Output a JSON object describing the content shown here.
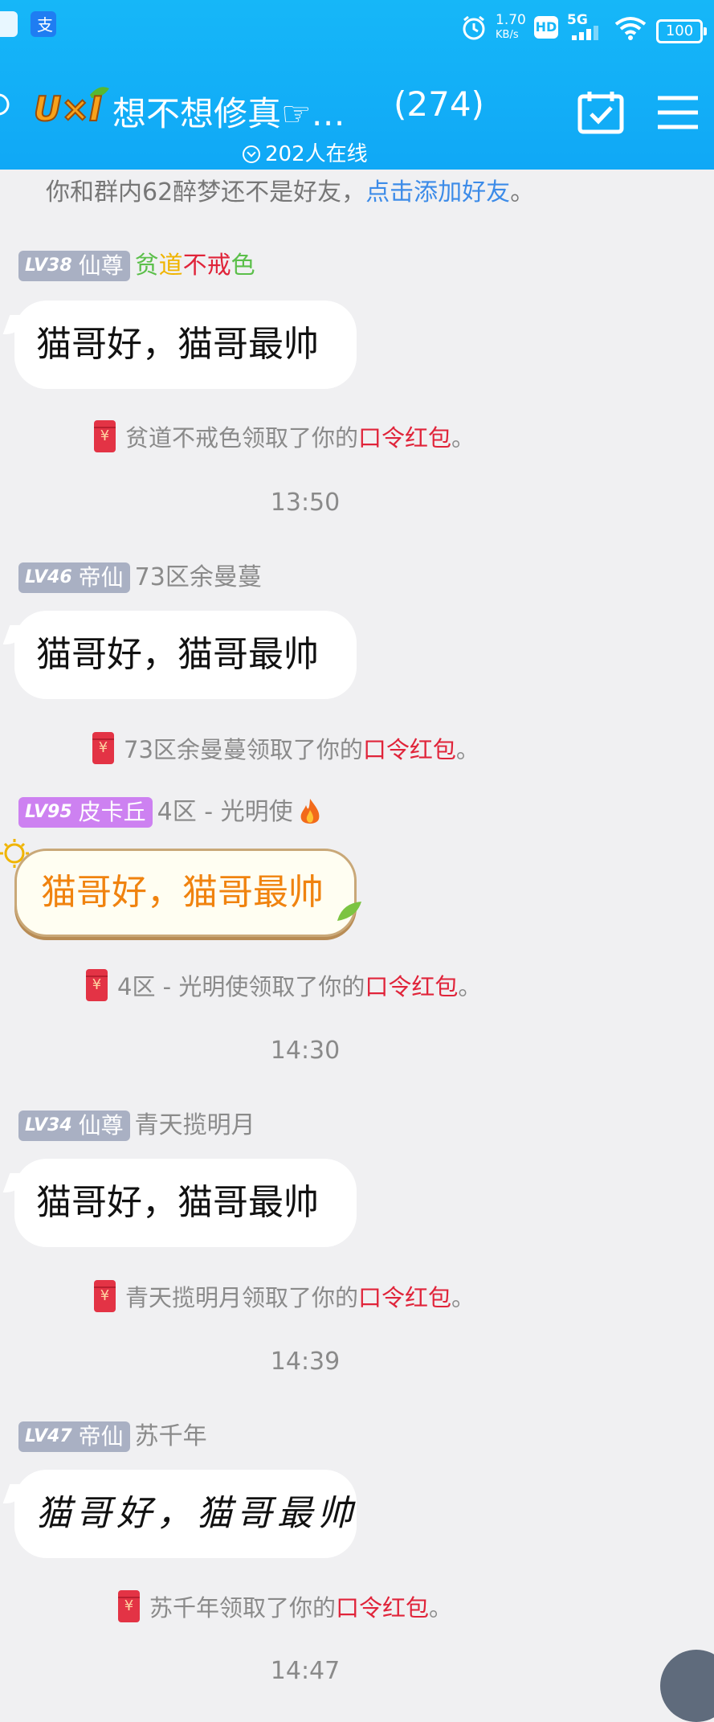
{
  "status_bar": {
    "speed_value": "1.70",
    "speed_unit": "KB/s",
    "hd": "HD",
    "network": "5G",
    "battery": "100"
  },
  "header": {
    "logo_text": "U×I",
    "title": "想不想修真☞…",
    "member_count": "(274)",
    "online_text": "202人在线"
  },
  "notice": {
    "prefix": "你和群内62醉梦还不是好友，",
    "link": "点击添加好友",
    "suffix": "。"
  },
  "colors": {
    "header_blue": "#16b7f8",
    "link_blue": "#3c8be8",
    "red_text": "#e0243a",
    "special_bubble_text": "#f0830f"
  },
  "messages": [
    {
      "level": "LV38",
      "title": "仙尊",
      "name_colored": [
        {
          "text": "贫",
          "color": "#5bbf4a"
        },
        {
          "text": "道",
          "color": "#f0b400"
        },
        {
          "text": "不",
          "color": "#e0243a"
        },
        {
          "text": "戒",
          "color": "#e0243a"
        },
        {
          "text": "色",
          "color": "#5bbf4a"
        }
      ],
      "text": "猫哥好，猫哥最帅",
      "receipt_name": "贫道不戒色领取了你的",
      "receipt_packet": "口令红包",
      "receipt_end": "。"
    },
    {
      "level": "LV46",
      "title": "帝仙",
      "name": "73区余曼蔓",
      "text": "猫哥好，猫哥最帅",
      "receipt_name": "73区余曼蔓领取了你的",
      "receipt_packet": "口令红包",
      "receipt_end": "。"
    },
    {
      "level": "LV95",
      "title": "皮卡丘",
      "name": "4区 - 光明使",
      "text": "猫哥好，猫哥最帅",
      "receipt_name": "4区 - 光明使领取了你的",
      "receipt_packet": "口令红包",
      "receipt_end": "。"
    },
    {
      "level": "LV34",
      "title": "仙尊",
      "name": "青天揽明月",
      "text": "猫哥好，猫哥最帅",
      "receipt_name": "青天揽明月领取了你的",
      "receipt_packet": "口令红包",
      "receipt_end": "。"
    },
    {
      "level": "LV47",
      "title": "帝仙",
      "name": "苏千年",
      "text": "猫哥好，猫哥最帅",
      "receipt_name": "苏千年领取了你的",
      "receipt_packet": "口令红包",
      "receipt_end": "。"
    }
  ],
  "times": [
    "13:50",
    "14:30",
    "14:39",
    "14:47"
  ],
  "envelope_symbol": "¥"
}
